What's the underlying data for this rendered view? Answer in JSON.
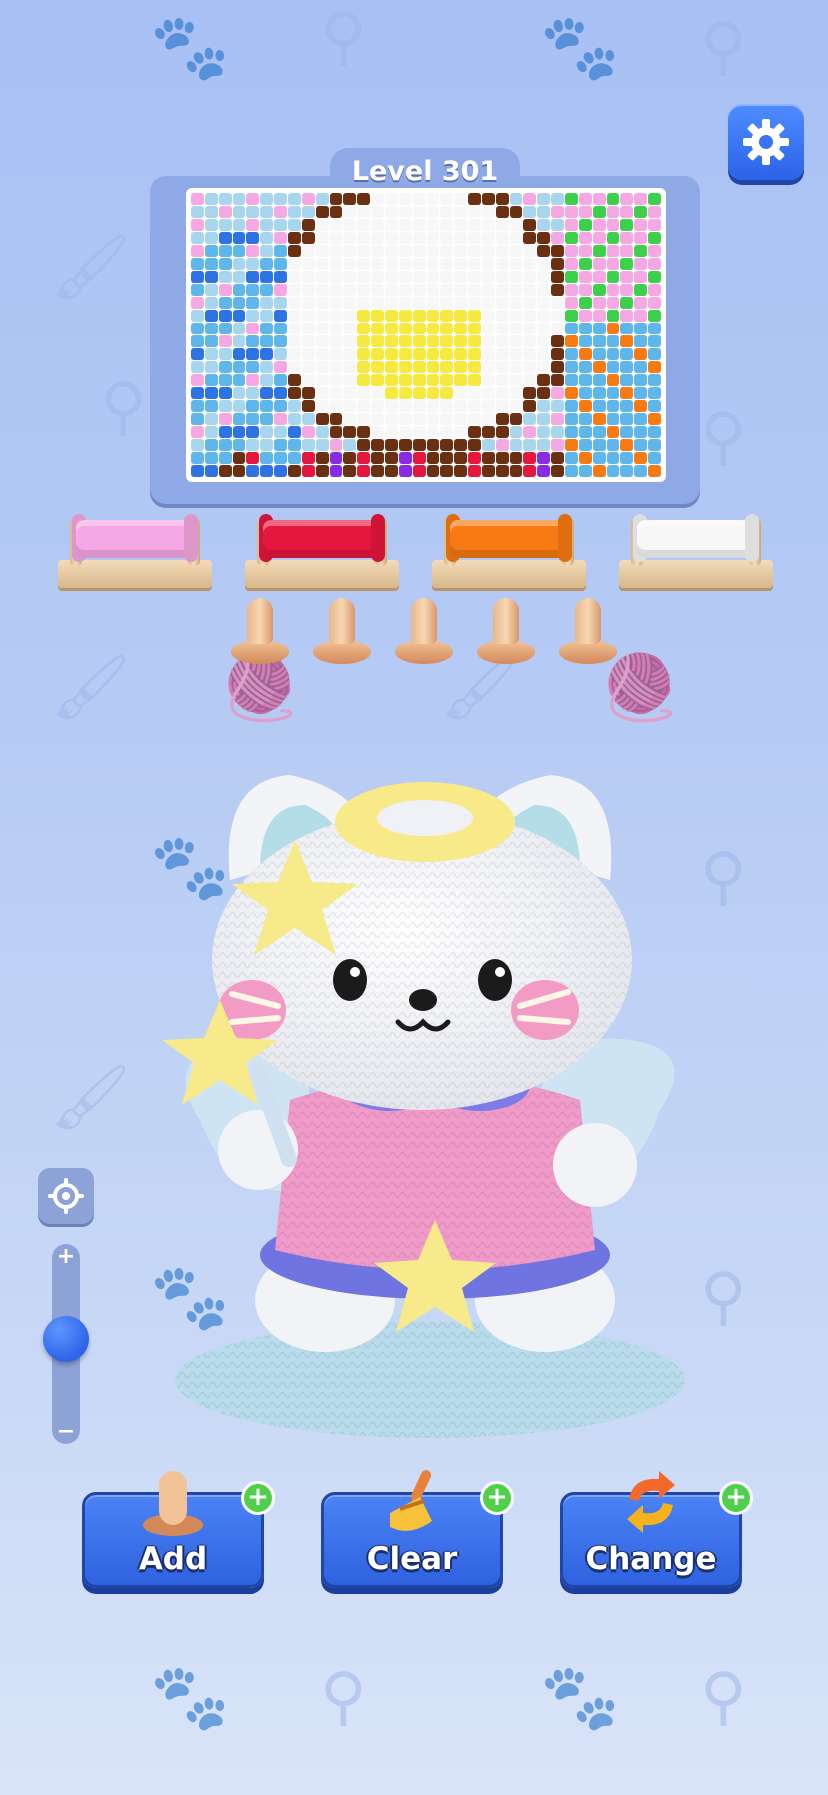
{
  "level": {
    "label": "Level 301"
  },
  "settings": {
    "icon": "gear-icon"
  },
  "spools": [
    {
      "color": "#f6a8e4"
    },
    {
      "color": "#e5173e"
    },
    {
      "color": "#f77a12"
    },
    {
      "color": "#f7f7f7"
    }
  ],
  "pegs": {
    "count": 5
  },
  "zoom": {
    "level": 0.55,
    "plus": "+",
    "minus": "−"
  },
  "boosters": {
    "add": {
      "label": "Add",
      "icon": "peg-icon"
    },
    "clear": {
      "label": "Clear",
      "icon": "broom-icon"
    },
    "change": {
      "label": "Change",
      "icon": "swap-arrows-icon"
    }
  },
  "colors": {
    "accent": "#2f62df",
    "background": "#b6cbf4",
    "plus_badge": "#4fcf4a"
  }
}
